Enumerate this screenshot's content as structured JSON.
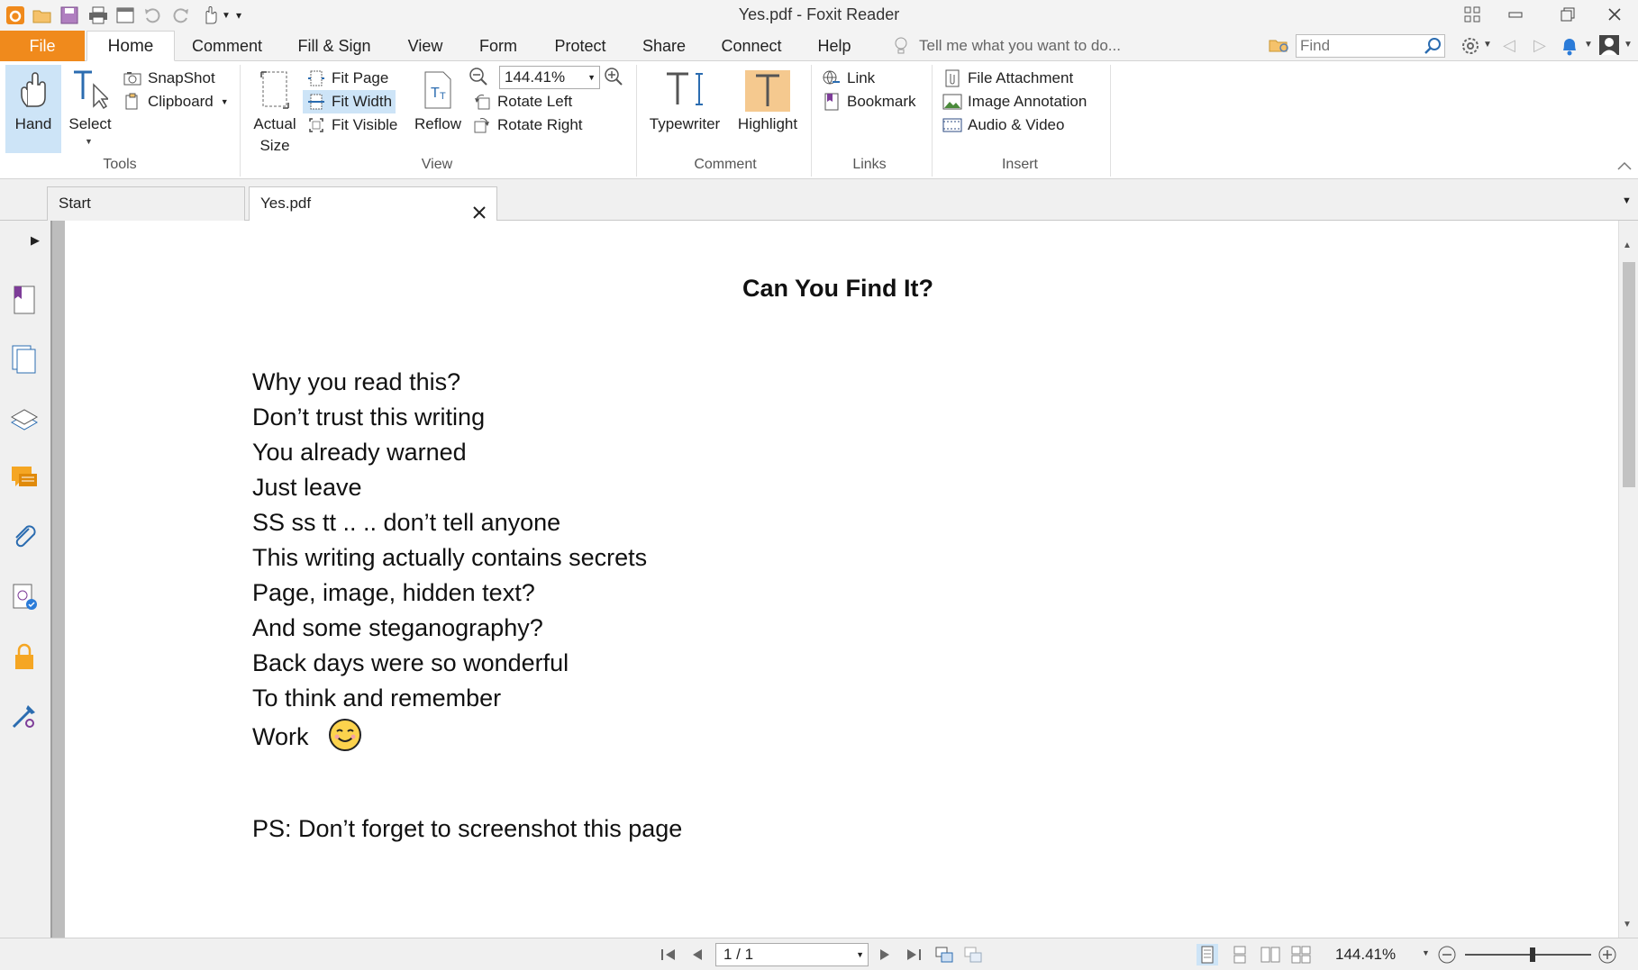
{
  "window": {
    "title": "Yes.pdf - Foxit Reader"
  },
  "menu": {
    "tabs": [
      "File",
      "Home",
      "Comment",
      "Fill & Sign",
      "View",
      "Form",
      "Protect",
      "Share",
      "Connect",
      "Help"
    ],
    "tell_me_placeholder": "Tell me what you want to do...",
    "find_placeholder": "Find"
  },
  "ribbon": {
    "tools": {
      "hand": "Hand",
      "select": "Select",
      "snapshot": "SnapShot",
      "clipboard": "Clipboard",
      "group": "Tools"
    },
    "view": {
      "actual_size_1": "Actual",
      "actual_size_2": "Size",
      "fit_page": "Fit Page",
      "fit_width": "Fit Width",
      "fit_visible": "Fit Visible",
      "reflow": "Reflow",
      "zoom": "144.41%",
      "rotate_left": "Rotate Left",
      "rotate_right": "Rotate Right",
      "group": "View"
    },
    "comment": {
      "typewriter": "Typewriter",
      "highlight": "Highlight",
      "group": "Comment"
    },
    "links": {
      "link": "Link",
      "bookmark": "Bookmark",
      "group": "Links"
    },
    "insert": {
      "file_attachment": "File Attachment",
      "image_annotation": "Image Annotation",
      "audio_video": "Audio & Video",
      "group": "Insert"
    }
  },
  "doc_tabs": [
    "Start",
    "Yes.pdf"
  ],
  "document": {
    "title": "Can You Find It?",
    "lines": [
      "Why you read this?",
      "Don’t trust this writing",
      "You already warned",
      "Just leave",
      "SS ss tt .. .. don’t tell anyone",
      "This writing actually contains secrets",
      "Page, image, hidden text?",
      "And some steganography?",
      "Back days were so wonderful",
      "To think and remember",
      "Work"
    ],
    "emoji": "😊",
    "ps": "PS: Don’t forget to screenshot this page"
  },
  "status": {
    "page": "1 / 1",
    "zoom": "144.41%"
  },
  "colors": {
    "accent": "#f08a1c",
    "selected": "#cde4f7",
    "highlight_tool": "#f5c98f"
  }
}
